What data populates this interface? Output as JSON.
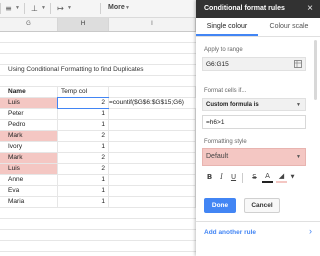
{
  "toolbar": {
    "more_label": "More",
    "icons": [
      "align-left-icon",
      "valign-icon",
      "text-wrap-icon"
    ]
  },
  "columns": [
    "G",
    "H",
    "I"
  ],
  "sheet": {
    "title": "Using Conditional Formatting to find Duplicates",
    "header_name": "Name",
    "header_temp": "Temp col",
    "formula": "=countif($G$6:$G$15;G6)",
    "rows": [
      {
        "name": "Luis",
        "count": "2",
        "dup": true
      },
      {
        "name": "Peter",
        "count": "1",
        "dup": false
      },
      {
        "name": "Pedro",
        "count": "1",
        "dup": false
      },
      {
        "name": "Mark",
        "count": "2",
        "dup": true
      },
      {
        "name": "Ivory",
        "count": "1",
        "dup": false
      },
      {
        "name": "Mark",
        "count": "2",
        "dup": true
      },
      {
        "name": "Luis",
        "count": "2",
        "dup": true
      },
      {
        "name": "Anne",
        "count": "1",
        "dup": false
      },
      {
        "name": "Eva",
        "count": "1",
        "dup": false
      },
      {
        "name": "Maria",
        "count": "1",
        "dup": false
      }
    ]
  },
  "panel": {
    "title": "Conditional format rules",
    "tab_single": "Single colour",
    "tab_scale": "Colour scale",
    "apply_label": "Apply to range",
    "range_value": "G6:G15",
    "format_if_label": "Format cells if...",
    "condition": "Custom formula is",
    "formula_value": "=h6>1",
    "style_label": "Formatting style",
    "style_value": "Default",
    "done_label": "Done",
    "cancel_label": "Cancel",
    "add_rule_label": "Add another rule"
  },
  "colors": {
    "highlight": "#f4c7c3",
    "accent": "#4285f4",
    "header_dark": "#323232"
  }
}
